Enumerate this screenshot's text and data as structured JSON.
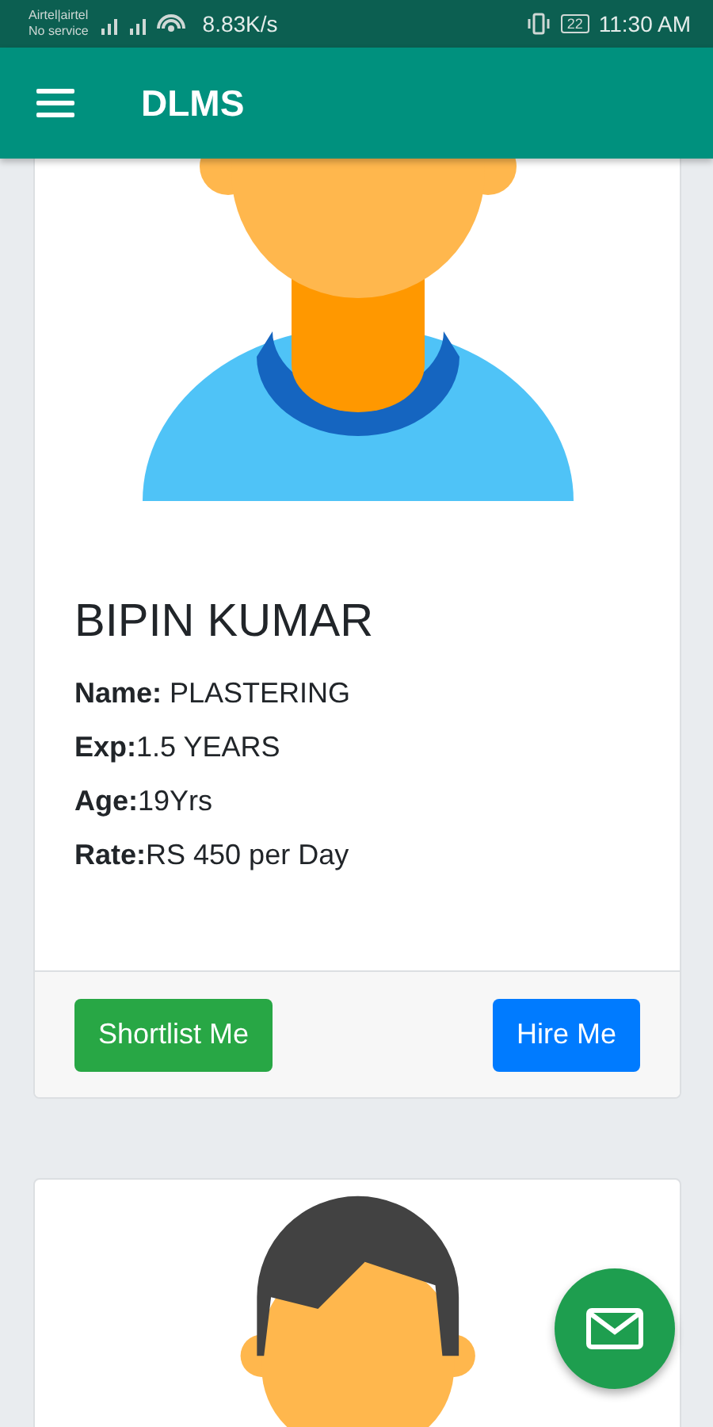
{
  "status_bar": {
    "carrier": "Airtel|airtel",
    "network_status": "No service",
    "speed": "8.83K/s",
    "battery": "22",
    "time": "11:30 AM"
  },
  "app_bar": {
    "title": "DLMS"
  },
  "workers": [
    {
      "avatar": {
        "hair": false
      },
      "name": "BIPIN KUMAR",
      "details": [
        "**Name:** PLASTERING",
        "**Exp:**1.5 YEARS",
        "**Age:**19Yrs",
        "**Rate:**RS 450 per Day"
      ],
      "buttons": [
        {
          "label": "Shortlist Me",
          "kind": "success"
        },
        {
          "label": "Hire Me",
          "kind": "primary"
        }
      ]
    },
    {
      "avatar": {
        "hair": true
      }
    }
  ]
}
